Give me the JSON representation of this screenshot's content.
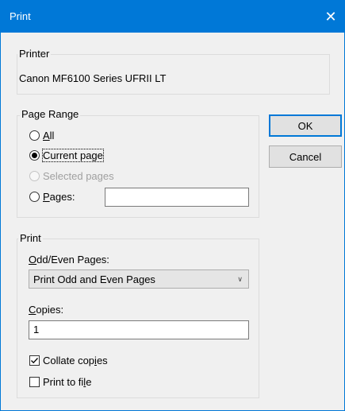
{
  "window": {
    "title": "Print",
    "close_icon": "close-icon"
  },
  "printer": {
    "group_label": "Printer",
    "name": "Canon MF6100 Series UFRII LT"
  },
  "page_range": {
    "group_label": "Page Range",
    "options": [
      {
        "label": "All",
        "checked": false,
        "enabled": true
      },
      {
        "label": "Current page",
        "checked": true,
        "enabled": true
      },
      {
        "label": "Selected pages",
        "checked": false,
        "enabled": false
      },
      {
        "label": "Pages:",
        "checked": false,
        "enabled": true
      }
    ],
    "pages_value": ""
  },
  "buttons": {
    "ok": "OK",
    "cancel": "Cancel"
  },
  "print": {
    "group_label": "Print",
    "odd_even_label": "Odd/Even Pages:",
    "odd_even_value": "Print Odd and Even Pages",
    "copies_label": "Copies:",
    "copies_value": "1",
    "collate_label": "Collate copies",
    "collate_checked": true,
    "print_to_file_label": "Print to file",
    "print_to_file_checked": false
  }
}
